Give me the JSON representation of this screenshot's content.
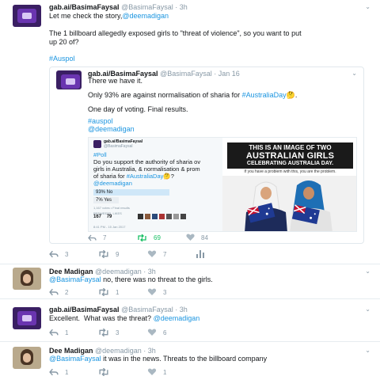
{
  "tweets": [
    {
      "name": "gab.ai/BasimaFaysal",
      "handle": "@BasimaFaysal",
      "time": "· 3h",
      "line1_prefix": "Let me check the story,",
      "line1_mention": "@deemadigan",
      "line2": "The 1 billboard allegedly exposed girls to \"threat of violence\", so you want to put",
      "line3": "up 20 of?",
      "hashtag": "#Auspol",
      "actions": {
        "reply": "3",
        "retweet": "9",
        "like": "7"
      }
    },
    {
      "name": "Dee Madigan",
      "handle": "@deemadigan",
      "time": "· 3h",
      "mention": "@BasimaFaysal",
      "text": " no, there was no threat to the girls.",
      "actions": {
        "reply": "2",
        "retweet": "1",
        "like": "3"
      }
    },
    {
      "name": "gab.ai/BasimaFaysal",
      "handle": "@BasimaFaysal",
      "time": "· 3h",
      "text": "Excellent.  What was the threat? ",
      "mention": "@deemadigan",
      "actions": {
        "reply": "1",
        "retweet": "3",
        "like": "6"
      }
    },
    {
      "name": "Dee Madigan",
      "handle": "@deemadigan",
      "time": "· 3h",
      "mention": "@BasimaFaysal",
      "text": " it was in the news. Threats to the billboard company",
      "actions": {
        "reply": "1",
        "retweet": "",
        "like": "1"
      }
    }
  ],
  "quoted": {
    "name": "gab.ai/BasimaFaysal",
    "handle": "@BasimaFaysal",
    "time": "· Jan 16",
    "line1": "There we have it.",
    "line2_prefix": "Only 93% are against normalisation of sharia for ",
    "line2_tag": "#AustraliaDay",
    "line2_suffix": "🤔.",
    "line3": "One day of voting. Final results.",
    "tag": "#auspol",
    "mention": "@deemadigan",
    "actions": {
      "reply": "7",
      "retweet": "69",
      "like": "84"
    }
  },
  "embedded": {
    "name": "gab.ai/BasimaFaysal",
    "handle": "@BasimaFaysal",
    "poll_tag": "#Poll",
    "q1": "Do you support the authority of sharia ov",
    "q2": "girls in Australia, & normalisation & prom",
    "q3_prefix": "of sharia for ",
    "q3_tag": "#AustraliaDay",
    "q3_suffix": "🤔?",
    "mention": "@deemadigan",
    "opt1": "93% No",
    "opt2": "7% Yes",
    "votes": "1,167 votes • Final results",
    "rt_label": "RETWEETS",
    "likes_label": "LIKES",
    "rt_count": "167",
    "likes_count": "79",
    "date": "8:41 PM - 15 Jan 2017"
  },
  "poster": {
    "title1": "THIS IS AN IMAGE OF TWO",
    "title2": "AUSTRALIAN GIRLS",
    "title3": "CELEBRATING AUSTRALIA DAY.",
    "subtitle": "If you have a problem with this, you are the problem."
  },
  "colors": {
    "link": "#1b95e0",
    "muted": "#8899a6",
    "retweet_active": "#17bf63",
    "divider": "#e6ecf0"
  }
}
